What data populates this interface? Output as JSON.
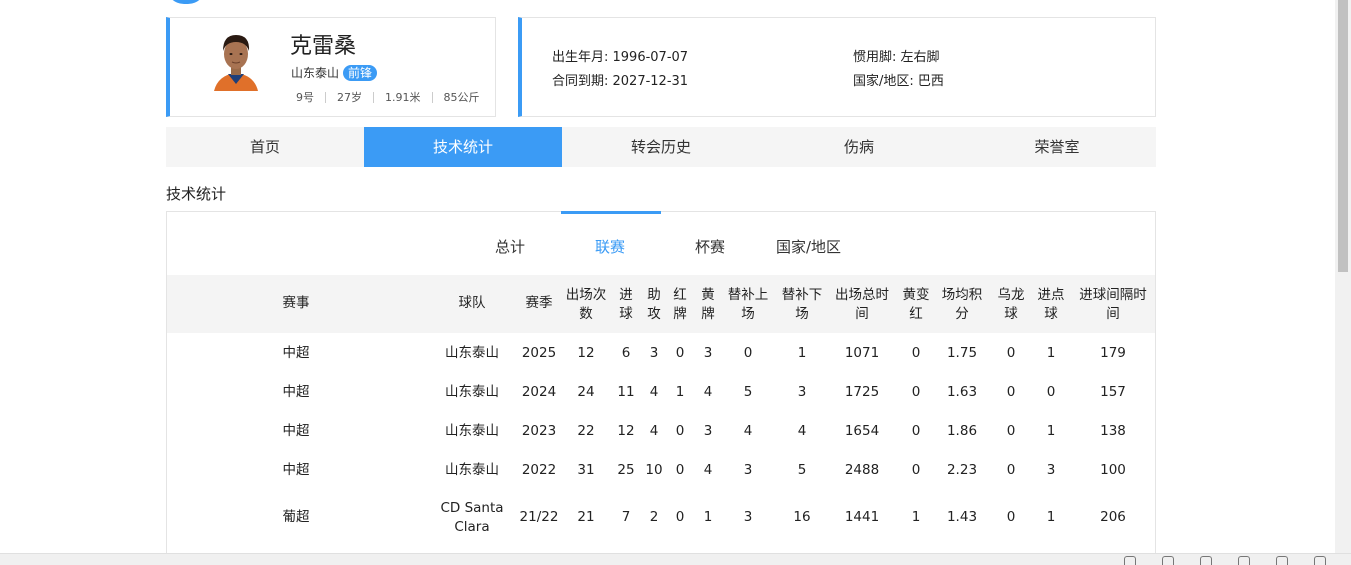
{
  "player": {
    "name": "克雷桑",
    "team": "山东泰山",
    "position": "前锋",
    "number": "9号",
    "age": "27岁",
    "height": "1.91米",
    "weight": "85公斤"
  },
  "info": {
    "birth": "出生年月: 1996-07-07",
    "contract": "合同到期: 2027-12-31",
    "foot": "惯用脚: 左右脚",
    "nation": "国家/地区: 巴西"
  },
  "tabs": [
    "首页",
    "技术统计",
    "转会历史",
    "伤病",
    "荣誉室"
  ],
  "section_title": "技术统计",
  "sub_tabs": [
    "总计",
    "联赛",
    "杯赛",
    "国家/地区"
  ],
  "table": {
    "headers": [
      [
        "赛事"
      ],
      [
        "球队"
      ],
      [
        "赛季"
      ],
      [
        "出场次",
        "数"
      ],
      [
        "进",
        "球"
      ],
      [
        "助",
        "攻"
      ],
      [
        "红",
        "牌"
      ],
      [
        "黄",
        "牌"
      ],
      [
        "替补上",
        "场"
      ],
      [
        "替补下",
        "场"
      ],
      [
        "出场总时",
        "间"
      ],
      [
        "黄变",
        "红"
      ],
      [
        "场均积",
        "分"
      ],
      [
        "乌龙",
        "球"
      ],
      [
        "进点",
        "球"
      ],
      [
        "进球间隔时",
        "间"
      ]
    ],
    "rows": [
      [
        [
          "中超"
        ],
        [
          "山东泰山"
        ],
        [
          "2025"
        ],
        [
          "12"
        ],
        [
          "6"
        ],
        [
          "3"
        ],
        [
          "0"
        ],
        [
          "3"
        ],
        [
          "0"
        ],
        [
          "1"
        ],
        [
          "1071"
        ],
        [
          "0"
        ],
        [
          "1.75"
        ],
        [
          "0"
        ],
        [
          "1"
        ],
        [
          "179"
        ]
      ],
      [
        [
          "中超"
        ],
        [
          "山东泰山"
        ],
        [
          "2024"
        ],
        [
          "24"
        ],
        [
          "11"
        ],
        [
          "4"
        ],
        [
          "1"
        ],
        [
          "4"
        ],
        [
          "5"
        ],
        [
          "3"
        ],
        [
          "1725"
        ],
        [
          "0"
        ],
        [
          "1.63"
        ],
        [
          "0"
        ],
        [
          "0"
        ],
        [
          "157"
        ]
      ],
      [
        [
          "中超"
        ],
        [
          "山东泰山"
        ],
        [
          "2023"
        ],
        [
          "22"
        ],
        [
          "12"
        ],
        [
          "4"
        ],
        [
          "0"
        ],
        [
          "3"
        ],
        [
          "4"
        ],
        [
          "4"
        ],
        [
          "1654"
        ],
        [
          "0"
        ],
        [
          "1.86"
        ],
        [
          "0"
        ],
        [
          "1"
        ],
        [
          "138"
        ]
      ],
      [
        [
          "中超"
        ],
        [
          "山东泰山"
        ],
        [
          "2022"
        ],
        [
          "31"
        ],
        [
          "25"
        ],
        [
          "10"
        ],
        [
          "0"
        ],
        [
          "4"
        ],
        [
          "3"
        ],
        [
          "5"
        ],
        [
          "2488"
        ],
        [
          "0"
        ],
        [
          "2.23"
        ],
        [
          "0"
        ],
        [
          "3"
        ],
        [
          "100"
        ]
      ],
      [
        [
          "葡超"
        ],
        [
          "CD Santa",
          "Clara"
        ],
        [
          "21/22"
        ],
        [
          "21"
        ],
        [
          "7"
        ],
        [
          "2"
        ],
        [
          "0"
        ],
        [
          "1"
        ],
        [
          "3"
        ],
        [
          "16"
        ],
        [
          "1441"
        ],
        [
          "1"
        ],
        [
          "1.43"
        ],
        [
          "0"
        ],
        [
          "1"
        ],
        [
          "206"
        ]
      ]
    ]
  },
  "colors": {
    "accent": "#3b9bf5",
    "header_bg": "#f4f4f4",
    "tab_bg": "#f5f5f5"
  }
}
